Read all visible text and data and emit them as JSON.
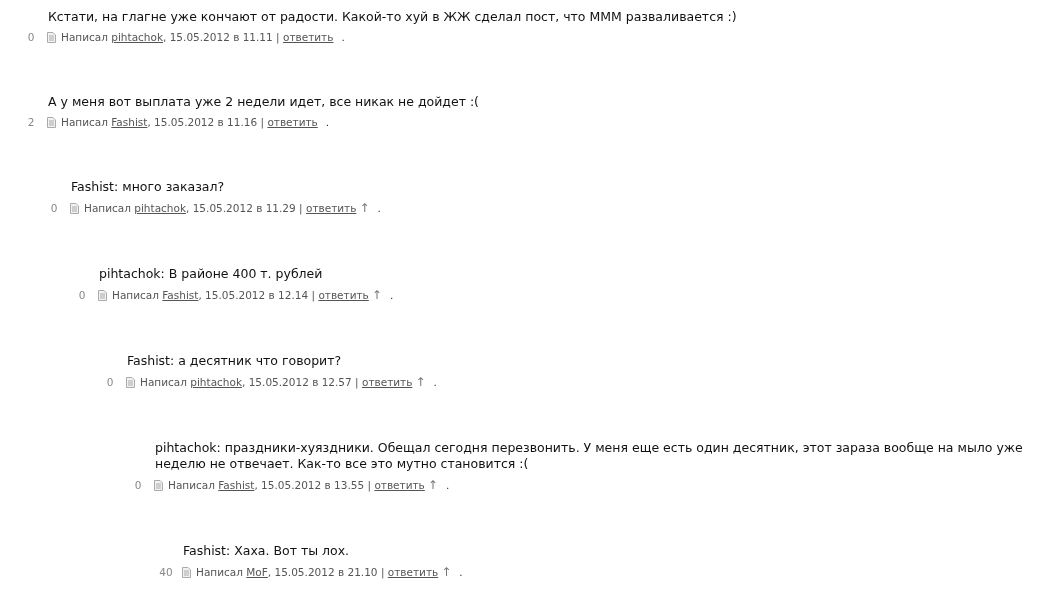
{
  "comments": [
    {
      "text": "Кстати, на глагне уже кончают от радости. Какой-то хуй в ЖЖ сделал пост, что МММ разваливается :)",
      "score": "0",
      "written": "Написал",
      "author": "pihtachok",
      "date": ", 15.05.2012 в 11.11",
      "sep": "|",
      "reply": "ответить",
      "end": "."
    },
    {
      "text": "А у меня вот выплата уже 2 недели идет, все никак не дойдет :(",
      "score": "2",
      "written": "Написал",
      "author": "Fashist",
      "date": ", 15.05.2012 в 11.16",
      "sep": "|",
      "reply": "ответить",
      "end": ".",
      "children": [
        {
          "text": "Fashist: много заказал?",
          "score": "0",
          "written": "Написал",
          "author": "pihtachok",
          "date": ", 15.05.2012 в 11.29",
          "sep": "|",
          "reply": "ответить",
          "up": "↑",
          "end": ".",
          "children": [
            {
              "text": "pihtachok: В районе 400 т. рублей",
              "score": "0",
              "written": "Написал",
              "author": "Fashist",
              "date": ", 15.05.2012 в 12.14",
              "sep": "|",
              "reply": "ответить",
              "up": "↑",
              "end": ".",
              "children": [
                {
                  "text": "Fashist: а десятник что говорит?",
                  "score": "0",
                  "written": "Написал",
                  "author": "pihtachok",
                  "date": ", 15.05.2012 в 12.57",
                  "sep": "|",
                  "reply": "ответить",
                  "up": "↑",
                  "end": ".",
                  "children": [
                    {
                      "text": "pihtachok: праздники-хуяздники. Обещал сегодня перезвонить. У меня еще есть один десятник, этот зараза вообще на мыло уже неделю не отвечает. Как-то все это мутно становится :(",
                      "score": "0",
                      "written": "Написал",
                      "author": "Fashist",
                      "date": ", 15.05.2012 в 13.55",
                      "sep": "|",
                      "reply": "ответить",
                      "up": "↑",
                      "end": ".",
                      "children": [
                        {
                          "text": "Fashist: Хаха. Вот ты лох.",
                          "score": "40",
                          "written": "Написал",
                          "author": "MoF",
                          "date": ", 15.05.2012 в 21.10",
                          "sep": "|",
                          "reply": "ответить",
                          "up": "↑",
                          "end": "."
                        }
                      ]
                    }
                  ]
                }
              ]
            }
          ]
        }
      ]
    }
  ]
}
